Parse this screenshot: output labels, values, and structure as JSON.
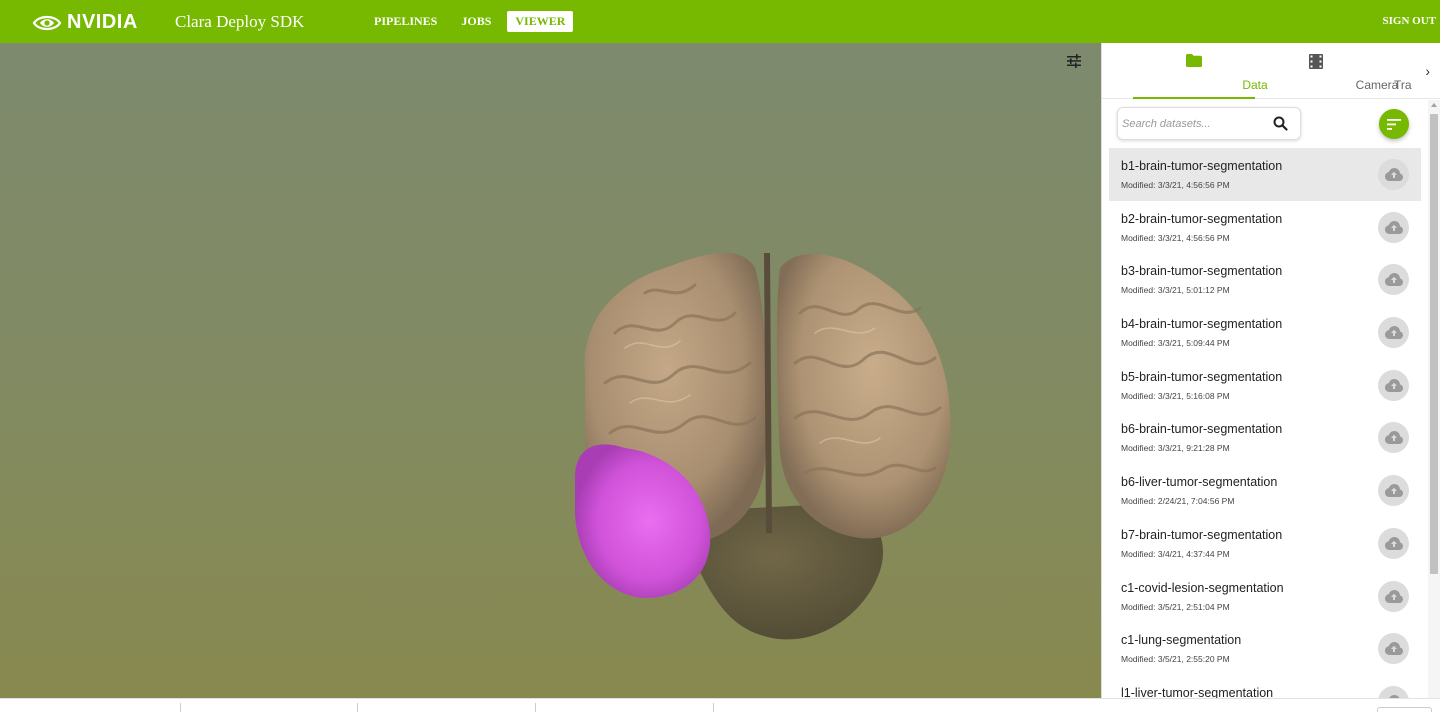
{
  "header": {
    "logo_text": "NVIDIA",
    "app_title": "Clara Deploy SDK",
    "nav": [
      {
        "label": "PIPELINES",
        "active": false
      },
      {
        "label": "JOBS",
        "active": false
      },
      {
        "label": "VIEWER",
        "active": true
      }
    ],
    "signout_label": "SIGN OUT",
    "brand_color": "#76b900"
  },
  "viewer": {
    "settings_icon": "tune-sliders-icon",
    "segmentation_color": "#d65be0"
  },
  "panel": {
    "tabs": [
      {
        "label": "Data",
        "icon": "folder-icon",
        "active": true
      },
      {
        "label": "Camera",
        "icon": "film-icon",
        "active": false
      },
      {
        "label": "Tra",
        "active": false
      }
    ],
    "tabs_next_icon": "chevron-right-icon",
    "search": {
      "placeholder": "Search datasets...",
      "value": ""
    },
    "filter_icon": "sort-lines-icon",
    "datasets": [
      {
        "name": "b1-brain-tumor-segmentation",
        "modified": "Modified: 3/3/21, 4:56:56 PM",
        "selected": true
      },
      {
        "name": "b2-brain-tumor-segmentation",
        "modified": "Modified: 3/3/21, 4:56:56 PM",
        "selected": false
      },
      {
        "name": "b3-brain-tumor-segmentation",
        "modified": "Modified: 3/3/21, 5:01:12 PM",
        "selected": false
      },
      {
        "name": "b4-brain-tumor-segmentation",
        "modified": "Modified: 3/3/21, 5:09:44 PM",
        "selected": false
      },
      {
        "name": "b5-brain-tumor-segmentation",
        "modified": "Modified: 3/3/21, 5:16:08 PM",
        "selected": false
      },
      {
        "name": "b6-brain-tumor-segmentation",
        "modified": "Modified: 3/3/21, 9:21:28 PM",
        "selected": false
      },
      {
        "name": "b6-liver-tumor-segmentation",
        "modified": "Modified: 2/24/21, 7:04:56 PM",
        "selected": false
      },
      {
        "name": "b7-brain-tumor-segmentation",
        "modified": "Modified: 3/4/21, 4:37:44 PM",
        "selected": false
      },
      {
        "name": "c1-covid-lesion-segmentation",
        "modified": "Modified: 3/5/21, 2:51:04 PM",
        "selected": false
      },
      {
        "name": "c1-lung-segmentation",
        "modified": "Modified: 3/5/21, 2:55:20 PM",
        "selected": false
      },
      {
        "name": "l1-liver-tumor-segmentation",
        "modified": "",
        "selected": false
      }
    ],
    "upload_icon": "cloud-upload-icon"
  }
}
